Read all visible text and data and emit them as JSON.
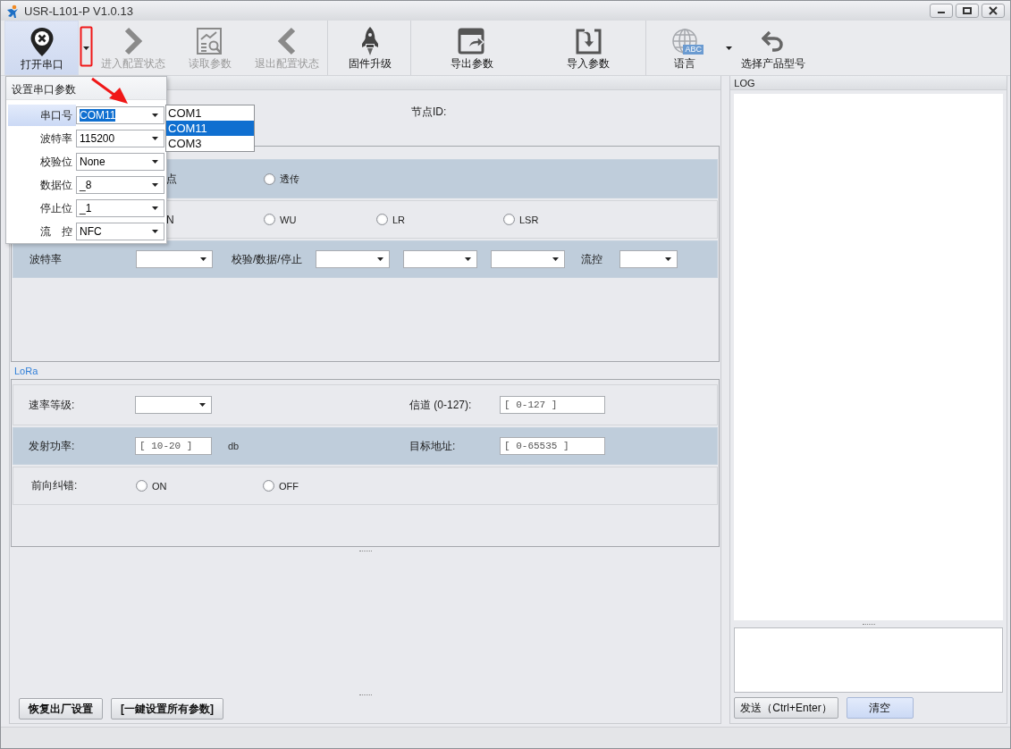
{
  "window": {
    "title": "USR-L101-P V1.0.13"
  },
  "toolbar": {
    "groups": [
      [
        {
          "kind": "button",
          "label": "打开串口",
          "disabled": false,
          "pressed": true
        },
        {
          "kind": "caret",
          "disabled": false,
          "pressed": false
        },
        {
          "kind": "button",
          "label": "进入配置状态",
          "disabled": true,
          "pressed": false
        },
        {
          "kind": "button",
          "label": "读取参数",
          "disabled": true,
          "pressed": false
        },
        {
          "kind": "button",
          "label": "退出配置状态",
          "disabled": true,
          "pressed": false
        }
      ],
      [
        {
          "kind": "button",
          "label": "固件升级",
          "disabled": false,
          "pressed": false
        }
      ],
      [
        {
          "kind": "button",
          "label": "导出参数",
          "disabled": false,
          "pressed": false
        },
        {
          "kind": "button",
          "label": "导入参数",
          "disabled": false,
          "pressed": false
        }
      ],
      [
        {
          "kind": "button",
          "label": "语言",
          "badge": "ABC",
          "disabled": false,
          "pressed": false
        },
        {
          "kind": "caret",
          "disabled": false,
          "pressed": false
        },
        {
          "kind": "button",
          "label": "选择产品型号",
          "disabled": false,
          "pressed": false
        }
      ]
    ]
  },
  "node": {
    "label": "节点ID:"
  },
  "mode_group": {
    "rows": [
      {
        "shaded": true,
        "items": [
          {
            "kind": "text",
            "label": "点"
          },
          {
            "kind": "radio",
            "label": "透传",
            "selected": false
          }
        ]
      },
      {
        "shaded": false,
        "items": [
          {
            "kind": "text",
            "label": "N"
          },
          {
            "kind": "radio",
            "label": "WU",
            "selected": false
          },
          {
            "kind": "radio",
            "label": "LR",
            "selected": false
          },
          {
            "kind": "radio",
            "label": "LSR",
            "selected": false
          }
        ]
      },
      {
        "shaded": true,
        "items": [
          {
            "kind": "label",
            "label": "波特率"
          },
          {
            "kind": "combo"
          },
          {
            "kind": "label",
            "label": "校验/数据/停止"
          },
          {
            "kind": "combo"
          },
          {
            "kind": "combo"
          },
          {
            "kind": "combo"
          },
          {
            "kind": "label",
            "label": "流控"
          },
          {
            "kind": "combo"
          }
        ]
      }
    ]
  },
  "lora": {
    "title": "LoRa",
    "rows": [
      {
        "shaded": false,
        "items": [
          {
            "kind": "label",
            "label": "速率等级:"
          },
          {
            "kind": "combo"
          },
          {
            "kind": "label",
            "label": "信道 (0-127):"
          },
          {
            "kind": "input",
            "placeholder": "[ 0-127 ]"
          }
        ]
      },
      {
        "shaded": true,
        "items": [
          {
            "kind": "label",
            "label": "发射功率:"
          },
          {
            "kind": "input",
            "placeholder": "[ 10-20 ]"
          },
          {
            "kind": "unit",
            "label": "db"
          },
          {
            "kind": "label",
            "label": "目标地址:"
          },
          {
            "kind": "input",
            "placeholder": "[ 0-65535 ]"
          }
        ]
      },
      {
        "shaded": false,
        "items": [
          {
            "kind": "label",
            "label": "前向纠错:"
          },
          {
            "kind": "radio",
            "label": "ON",
            "selected": false
          },
          {
            "kind": "radio",
            "label": "OFF",
            "selected": false
          }
        ]
      }
    ]
  },
  "bottom_buttons": [
    "恢复出厂设置",
    "[一鍵设置所有参数]"
  ],
  "log": {
    "title": "LOG",
    "buttons": [
      {
        "label": "发送（Ctrl+Enter）",
        "focused": false
      },
      {
        "label": "清空",
        "focused": true
      }
    ]
  },
  "serial_popup": {
    "title": "设置串口参数",
    "fields": [
      {
        "label": "串口号",
        "value": "COM11",
        "focused": true
      },
      {
        "label": "波特率",
        "value": "115200",
        "focused": false
      },
      {
        "label": "校验位",
        "value": "None",
        "focused": false
      },
      {
        "label": "数据位",
        "value": "_8",
        "focused": false
      },
      {
        "label": "停止位",
        "value": "_1",
        "focused": false
      },
      {
        "label": "流　控",
        "value": "NFC",
        "focused": false
      }
    ],
    "options": [
      {
        "label": "COM1",
        "selected": false
      },
      {
        "label": "COM11",
        "selected": true
      },
      {
        "label": "COM3",
        "selected": false
      }
    ]
  },
  "annotations": {
    "highlight_box": true,
    "arrow": true
  }
}
